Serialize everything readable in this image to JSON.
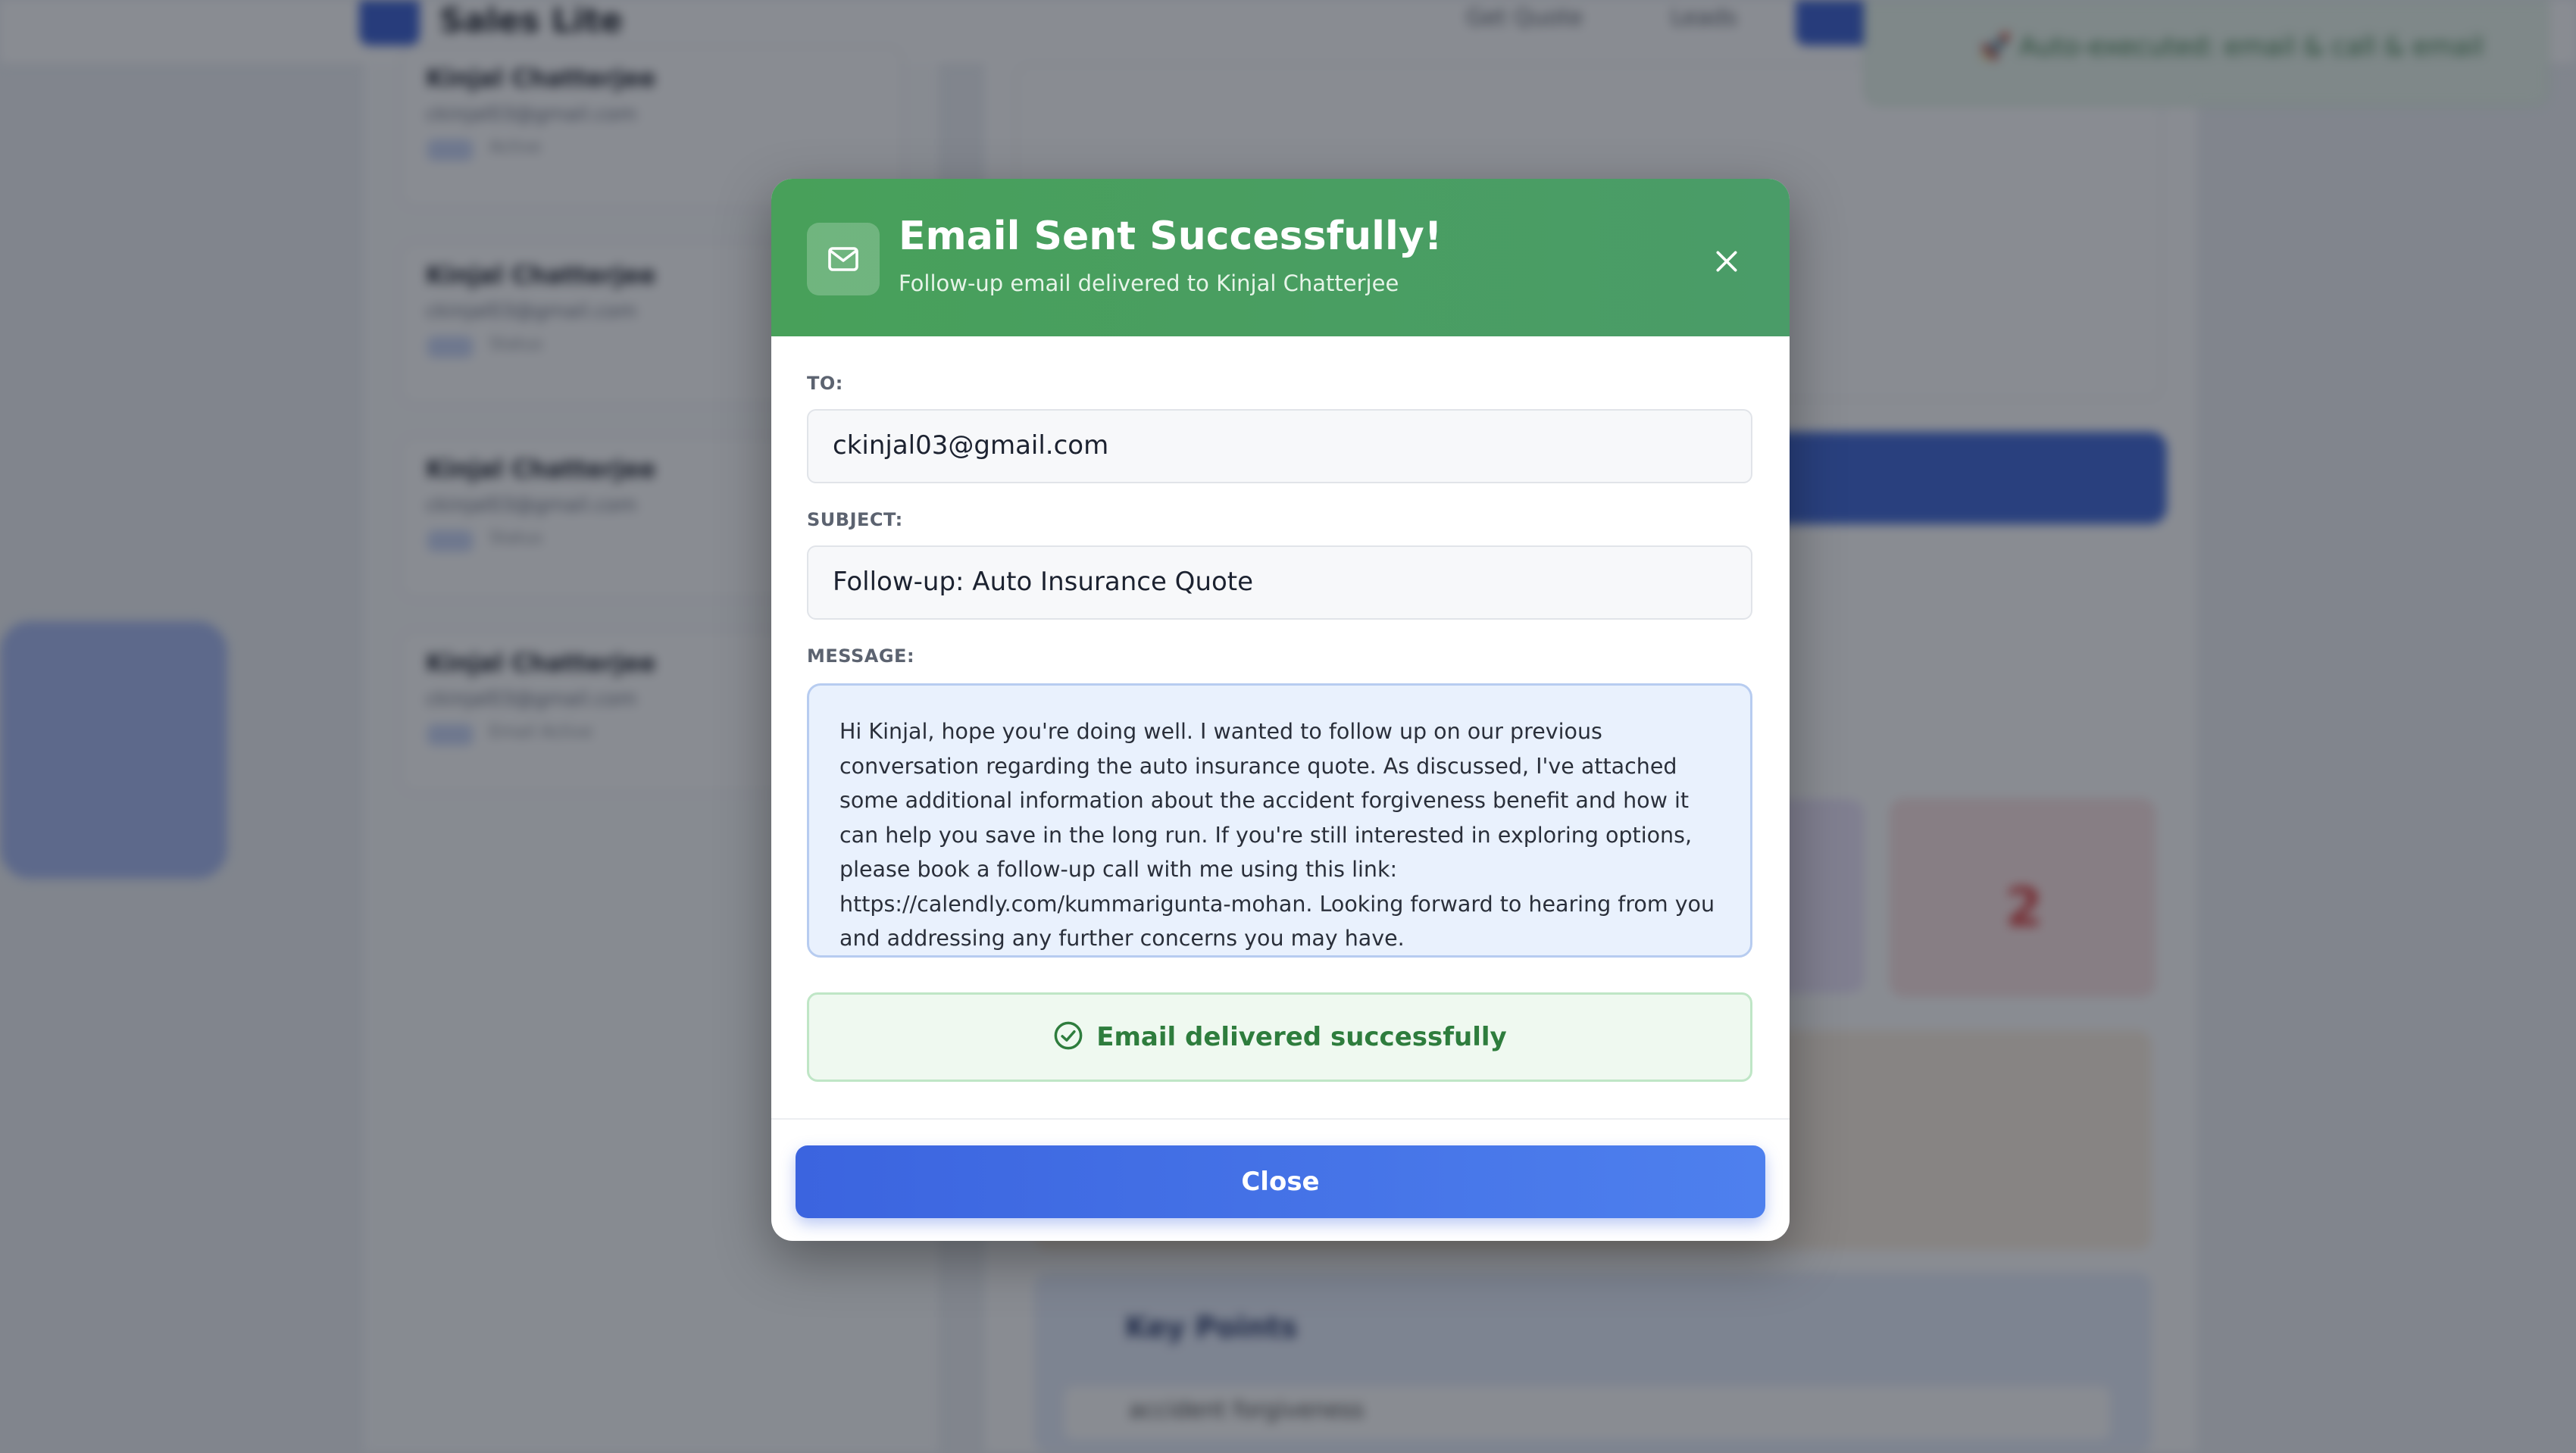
{
  "background": {
    "brand": "Sales Lite",
    "nav": [
      "Get Quote",
      "Leads"
    ],
    "toast_text": "🚀 Auto-executed: email & call & email",
    "lead_cards": [
      {
        "name": "Kinjal Chatterjee",
        "email": "ckinjal03@gmail.com",
        "status": "Active"
      },
      {
        "name": "Kinjal Chatterjee",
        "email": "ckinjal03@gmail.com",
        "status": "Status"
      },
      {
        "name": "Kinjal Chatterjee",
        "email": "ckinjal03@gmail.com",
        "status": "Status"
      },
      {
        "name": "Kinjal Chatterjee",
        "email": "ckinjal03@gmail.com",
        "status": "Email Active"
      }
    ],
    "stat_value": "2",
    "key_points_title": "Key Points",
    "key_point_1": "accident forgiveness"
  },
  "modal": {
    "title": "Email Sent Successfully!",
    "subtitle": "Follow-up email delivered to Kinjal Chatterjee",
    "header_icon": "mail-icon",
    "close_icon": "close-icon",
    "to_label": "TO:",
    "to_value": "ckinjal03@gmail.com",
    "subject_label": "SUBJECT:",
    "subject_value": "Follow-up: Auto Insurance Quote",
    "message_label": "MESSAGE:",
    "message_body": "Hi Kinjal, hope you're doing well. I wanted to follow up on our previous conversation regarding the auto insurance quote. As discussed, I've attached some additional information about the accident forgiveness benefit and how it can help you save in the long run. If you're still interested in exploring options, please book a follow-up call with me using this link: https://calendly.com/kummarigunta-mohan. Looking forward to hearing from you and addressing any further concerns you may have.",
    "status_text": "Email delivered successfully",
    "status_icon": "check-circle-icon",
    "close_button_label": "Close"
  },
  "colors": {
    "header_green": "#48a05a",
    "success_green": "#2e7d3d",
    "primary_blue": "#3b64df"
  }
}
